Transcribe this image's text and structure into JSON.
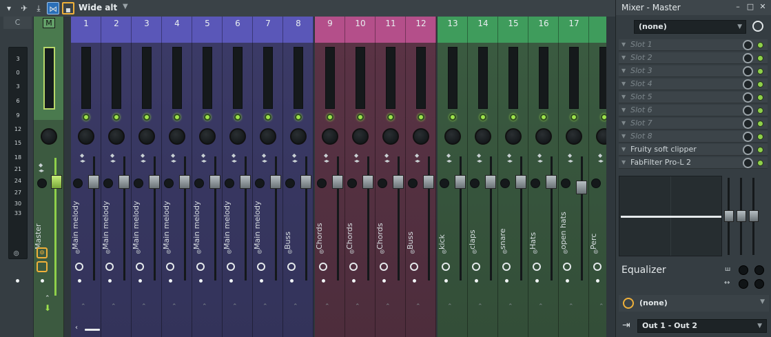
{
  "toolbar": {
    "preset_name": "Wide alt",
    "preset_arrow": "▼",
    "icons": [
      "menu-arrow-icon",
      "bird-icon",
      "download-icon",
      "link-icon",
      "square-icon"
    ]
  },
  "meter_panel": {
    "label": "C",
    "ticks": [
      "3",
      "0",
      "3",
      "6",
      "9",
      "12",
      "15",
      "18",
      "21",
      "24",
      "27",
      "30",
      "33"
    ]
  },
  "master": {
    "button": "M",
    "name": "Master"
  },
  "channels": [
    {
      "num": "1",
      "name": "Main melody",
      "color": "blue"
    },
    {
      "num": "2",
      "name": "Main melody",
      "color": "blue"
    },
    {
      "num": "3",
      "name": "Main melody",
      "color": "blue"
    },
    {
      "num": "4",
      "name": "Main melody",
      "color": "blue"
    },
    {
      "num": "5",
      "name": "Main melody",
      "color": "blue"
    },
    {
      "num": "6",
      "name": "Main melody",
      "color": "blue"
    },
    {
      "num": "7",
      "name": "Main melody",
      "color": "blue"
    },
    {
      "num": "8",
      "name": "Buss",
      "color": "blue"
    },
    {
      "num": "9",
      "name": "Chords",
      "color": "pink"
    },
    {
      "num": "10",
      "name": "Chords",
      "color": "pink"
    },
    {
      "num": "11",
      "name": "Chords",
      "color": "pink"
    },
    {
      "num": "12",
      "name": "Buss",
      "color": "pink"
    },
    {
      "num": "13",
      "name": "kick",
      "color": "green"
    },
    {
      "num": "14",
      "name": "claps",
      "color": "green"
    },
    {
      "num": "15",
      "name": "snare",
      "color": "green"
    },
    {
      "num": "16",
      "name": "Hats",
      "color": "green"
    },
    {
      "num": "17",
      "name": "open hats",
      "color": "green"
    },
    {
      "num": "",
      "name": "Perc",
      "color": "green"
    }
  ],
  "mixer_panel": {
    "title": "Mixer - Master",
    "preset": "(none)",
    "slots": [
      {
        "name": "Slot 1",
        "filled": false
      },
      {
        "name": "Slot 2",
        "filled": false
      },
      {
        "name": "Slot 3",
        "filled": false
      },
      {
        "name": "Slot 4",
        "filled": false
      },
      {
        "name": "Slot 5",
        "filled": false
      },
      {
        "name": "Slot 6",
        "filled": false
      },
      {
        "name": "Slot 7",
        "filled": false
      },
      {
        "name": "Slot 8",
        "filled": false
      },
      {
        "name": "Fruity soft clipper",
        "filled": true
      },
      {
        "name": "FabFilter Pro-L 2",
        "filled": true
      }
    ],
    "eq_label": "Equalizer",
    "route_value": "(none)",
    "output": "Out 1 - Out 2",
    "colors": {
      "accent": "#f0b13a",
      "led": "#8fd04a"
    }
  }
}
